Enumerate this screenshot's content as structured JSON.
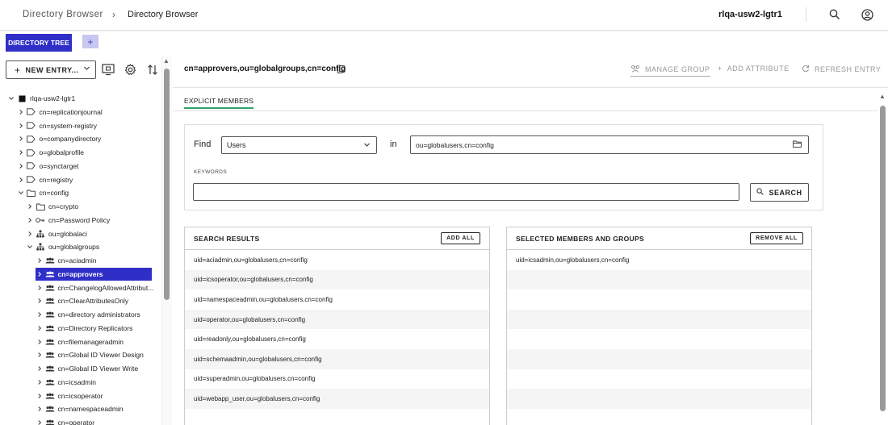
{
  "header": {
    "app_name": "Directory Browser",
    "breadcrumb_sep": "›",
    "breadcrumb_current": "Directory Browser",
    "server": "rlqa-usw2-lgtr1",
    "icons": [
      "search-icon",
      "user-account-icon"
    ]
  },
  "tabs": {
    "tree_tab": "DIRECTORY TREE",
    "add_tab": "+"
  },
  "toolbar": {
    "new_entry_label": "NEW ENTRY...",
    "icons": [
      "screen-icon",
      "gear-icon",
      "sort-icon"
    ]
  },
  "tree": {
    "items": [
      {
        "label": "rlqa-usw2-lgtr1",
        "icon": "server-icon",
        "expanded": true
      },
      {
        "label": "cn=replicationjournal",
        "icon": "tag-icon"
      },
      {
        "label": "cn=system-registry",
        "icon": "tag-icon"
      },
      {
        "label": "o=companydirectory",
        "icon": "tag-icon"
      },
      {
        "label": "o=globalprofile",
        "icon": "tag-icon"
      },
      {
        "label": "o=synctarget",
        "icon": "tag-icon"
      },
      {
        "label": "cn=registry",
        "icon": "tag-icon"
      },
      {
        "label": "cn=config",
        "icon": "folder-icon",
        "expanded": true
      },
      {
        "label": "cn=crypto",
        "icon": "folder-icon"
      },
      {
        "label": "cn=Password Policy",
        "icon": "key-icon"
      },
      {
        "label": "ou=globalaci",
        "icon": "hierarchy-icon"
      },
      {
        "label": "ou=globalgroups",
        "icon": "hierarchy-icon",
        "expanded": true
      },
      {
        "label": "cn=aciadmin",
        "icon": "group-icon"
      },
      {
        "label": "cn=approvers",
        "icon": "group-icon",
        "selected": true
      },
      {
        "label": "cn=ChangelogAllowedAttribut...",
        "icon": "group-icon"
      },
      {
        "label": "cn=ClearAttributesOnly",
        "icon": "group-icon"
      },
      {
        "label": "cn=directory administrators",
        "icon": "group-icon"
      },
      {
        "label": "cn=Directory Replicators",
        "icon": "group-icon"
      },
      {
        "label": "cn=filemanageradmin",
        "icon": "group-icon"
      },
      {
        "label": "cn=Global ID Viewer Design",
        "icon": "group-icon"
      },
      {
        "label": "cn=Global ID Viewer Write",
        "icon": "group-icon"
      },
      {
        "label": "cn=icsadmin",
        "icon": "group-icon"
      },
      {
        "label": "cn=icsoperator",
        "icon": "group-icon"
      },
      {
        "label": "cn=namespaceadmin",
        "icon": "group-icon"
      },
      {
        "label": "cn=operator",
        "icon": "group-icon"
      }
    ]
  },
  "entry": {
    "dn": "cn=approvers,ou=globalgroups,cn=config",
    "actions": {
      "manage_group": "MANAGE GROUP",
      "add_attribute": "ADD ATTRIBUTE",
      "refresh_entry": "REFRESH ENTRY"
    },
    "subtab": "EXPLICIT MEMBERS"
  },
  "find": {
    "find_label": "Find",
    "type_value": "Users",
    "in_label": "in",
    "base_dn": "ou=globalusers,cn=config",
    "keywords_label": "KEYWORDS",
    "keywords_value": "",
    "search_label": "SEARCH"
  },
  "search_results": {
    "title": "SEARCH RESULTS",
    "button": "ADD ALL",
    "rows": [
      "uid=aciadmin,ou=globalusers,cn=config",
      "uid=icsoperator,ou=globalusers,cn=config",
      "uid=namespaceadmin,ou=globalusers,cn=config",
      "uid=operator,ou=globalusers,cn=config",
      "uid=readonly,ou=globalusers,cn=config",
      "uid=schemaadmin,ou=globalusers,cn=config",
      "uid=superadmin,ou=globalusers,cn=config",
      "uid=webapp_user,ou=globalusers,cn=config"
    ]
  },
  "selected_members": {
    "title": "SELECTED MEMBERS AND GROUPS",
    "button": "REMOVE ALL",
    "rows": [
      "uid=icsadmin,ou=globalusers,cn=config"
    ]
  },
  "colors": {
    "accent": "#2f2fc8",
    "subtab_underline": "#2fa36b"
  }
}
